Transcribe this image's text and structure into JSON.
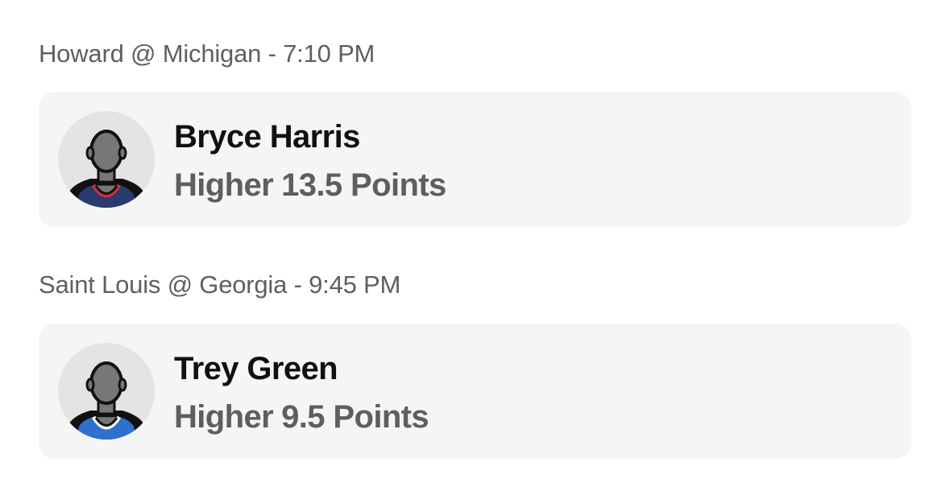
{
  "picks": [
    {
      "game": "Howard @ Michigan - 7:10 PM",
      "player": "Bryce Harris",
      "direction": "Higher",
      "line": "13.5 Points",
      "jersey_color": "#2a3a6e",
      "jersey_trim": "#c8323c",
      "avatar_icon": "player-silhouette-icon"
    },
    {
      "game": "Saint Louis @ Georgia - 9:45 PM",
      "player": "Trey Green",
      "direction": "Higher",
      "line": "9.5 Points",
      "jersey_color": "#2f6fd0",
      "jersey_trim": "#ffffff",
      "avatar_icon": "player-silhouette-icon"
    }
  ]
}
